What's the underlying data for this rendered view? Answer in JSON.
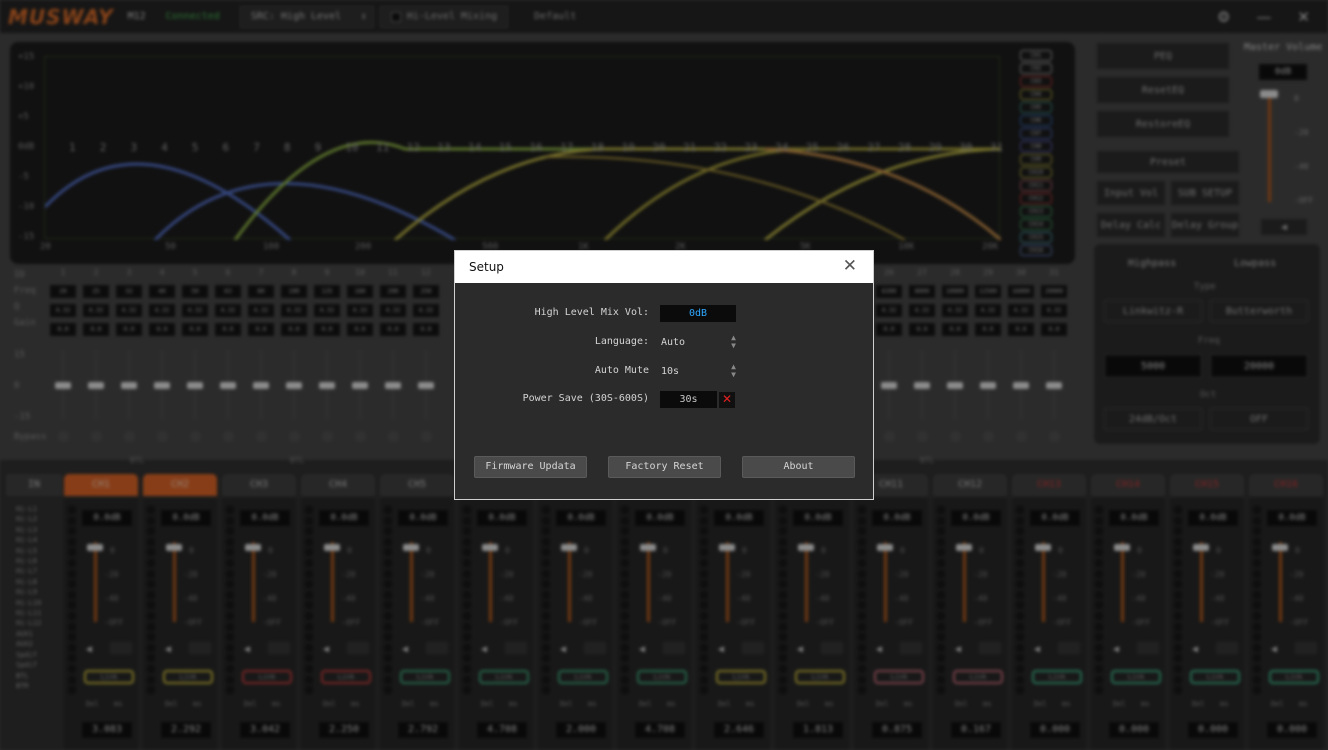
{
  "topbar": {
    "logo": "MUSWAY",
    "model": "M12",
    "status": "Connected",
    "source": "SRC: High Level",
    "mixing": "Hi-Level Mixing",
    "preset": "Default"
  },
  "eq": {
    "y_ticks": [
      "+15",
      "+10",
      "+5",
      "0dB",
      "-5",
      "-10",
      "-15"
    ],
    "x_ticks": [
      "20",
      "50",
      "100",
      "200",
      "500",
      "1K",
      "2K",
      "5K",
      "10K",
      "20K"
    ],
    "band_numbers": [
      "1",
      "2",
      "3",
      "4",
      "5",
      "6",
      "7",
      "8",
      "9",
      "10",
      "11",
      "12",
      "13",
      "14",
      "15",
      "16",
      "17",
      "18",
      "19",
      "20",
      "21",
      "22",
      "23",
      "24",
      "25",
      "26",
      "27",
      "28",
      "29",
      "30",
      "31"
    ],
    "channel_tags": [
      "CH1",
      "CH2",
      "CH3",
      "CH4",
      "CH5",
      "CH6",
      "CH7",
      "CH8",
      "CH9",
      "CH10",
      "CH11",
      "CH12",
      "CH13",
      "CH14",
      "CH15",
      "CH16"
    ],
    "row_labels": [
      "ID",
      "Freq",
      "Q",
      "Gain"
    ],
    "fader_labels": [
      "15",
      "0",
      "-15"
    ],
    "bypass_label": "Bypass",
    "ids": [
      "1",
      "2",
      "3",
      "4",
      "5",
      "6",
      "7",
      "8",
      "9",
      "10",
      "11",
      "12",
      "26",
      "27",
      "28",
      "29",
      "30",
      "31"
    ],
    "freqs": [
      "20",
      "25",
      "32",
      "40",
      "50",
      "63",
      "80",
      "100",
      "125",
      "160",
      "200",
      "250",
      "6300",
      "8000",
      "10000",
      "12500",
      "16000",
      "20000"
    ],
    "q_val": "4.32",
    "gain_val": "0.0"
  },
  "right": {
    "peq": "PEQ",
    "reset_eq": "ResetEQ",
    "restore_eq": "RestoreEQ",
    "preset": "Preset",
    "input_vol": "Input Vol",
    "sub_setup": "SUB SETUP",
    "delay_calc": "Delay Calc",
    "delay_group": "Delay Group",
    "master_title": "Master Volume",
    "master_val": "0dB",
    "master_ticks": [
      "0",
      "-20",
      "-40",
      "-OFF"
    ],
    "highpass": "Highpass",
    "lowpass": "Lowpass",
    "type_label": "Type",
    "hp_type": "Linkwitz-R",
    "lp_type": "Butterworth",
    "freq_label": "Freq",
    "hp_freq": "5000",
    "lp_freq": "20000",
    "oct_label": "Oct",
    "hp_oct": "24dB/Oct",
    "lp_oct": "OFF"
  },
  "channels": {
    "in_label": "IN",
    "inputs": [
      "Hi-L1",
      "Hi-L2",
      "Hi-L3",
      "Hi-L4",
      "Hi-L5",
      "Hi-L6",
      "Hi-L7",
      "Hi-L8",
      "Hi-L9",
      "Hi-L10",
      "Hi-L11",
      "Hi-L12",
      "AUX1",
      "AUX2",
      "Spdif",
      "Spdif",
      "BTL",
      "BTR"
    ],
    "btl_label": "BTL",
    "link_label": "Link",
    "del_label": "Del",
    "ms_label": "ms",
    "list": [
      {
        "name": "CH1",
        "gain": "0.0dB",
        "delay": "3.083",
        "tab": "on"
      },
      {
        "name": "CH2",
        "gain": "0.0dB",
        "delay": "2.292",
        "tab": "on"
      },
      {
        "name": "CH3",
        "gain": "0.0dB",
        "delay": "3.042",
        "tab": "off"
      },
      {
        "name": "CH4",
        "gain": "0.0dB",
        "delay": "2.250",
        "tab": "off"
      },
      {
        "name": "CH5",
        "gain": "0.0dB",
        "delay": "2.792",
        "tab": "off"
      },
      {
        "name": "CH6",
        "gain": "0.0dB",
        "delay": "4.708",
        "tab": "off"
      },
      {
        "name": "CH7",
        "gain": "0.0dB",
        "delay": "2.000",
        "tab": "off"
      },
      {
        "name": "CH8",
        "gain": "0.0dB",
        "delay": "4.708",
        "tab": "off"
      },
      {
        "name": "CH9",
        "gain": "0.0dB",
        "delay": "2.646",
        "tab": "off"
      },
      {
        "name": "CH10",
        "gain": "0.0dB",
        "delay": "1.813",
        "tab": "off"
      },
      {
        "name": "CH11",
        "gain": "0.0dB",
        "delay": "0.875",
        "tab": "off"
      },
      {
        "name": "CH12",
        "gain": "0.0dB",
        "delay": "0.167",
        "tab": "off"
      },
      {
        "name": "CH13",
        "gain": "0.0dB",
        "delay": "0.000",
        "tab": "red"
      },
      {
        "name": "CH14",
        "gain": "0.0dB",
        "delay": "0.000",
        "tab": "red"
      },
      {
        "name": "CH15",
        "gain": "0.0dB",
        "delay": "0.000",
        "tab": "red"
      },
      {
        "name": "CH16",
        "gain": "0.0dB",
        "delay": "0.000",
        "tab": "red"
      }
    ],
    "ticks": [
      "0",
      "-20",
      "-40",
      "-OFF"
    ]
  },
  "setup": {
    "title": "Setup",
    "close": "✕",
    "hl_vol_label": "High Level Mix Vol:",
    "hl_vol_value": "0dB",
    "language_label": "Language:",
    "language_value": "Auto",
    "auto_mute_label": "Auto Mute",
    "auto_mute_value": "10s",
    "power_save_label": "Power Save (30S-600S)",
    "power_save_value": "30s",
    "power_save_clear": "✕",
    "firmware_button": "Firmware Updata",
    "factory_button": "Factory Reset",
    "about_button": "About"
  }
}
